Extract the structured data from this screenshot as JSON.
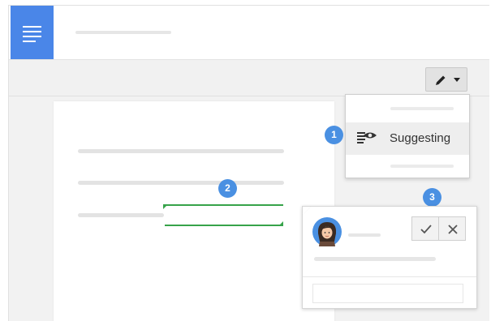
{
  "colors": {
    "app_blue": "#4a86e8",
    "suggestion_green": "#37a34a",
    "badge_blue": "#4a90e2"
  },
  "header": {
    "app_icon": "docs-lines-icon"
  },
  "toolbar": {
    "mode_button_icon": "pencil-icon",
    "mode_caret_icon": "caret-down-icon"
  },
  "mode_menu": {
    "selected_item": {
      "icon": "suggest-eye-icon",
      "label": "Suggesting"
    }
  },
  "callouts": [
    "1",
    "2",
    "3"
  ],
  "comment_card": {
    "avatar": "user-avatar",
    "accept_icon": "check-icon",
    "reject_icon": "close-icon"
  }
}
